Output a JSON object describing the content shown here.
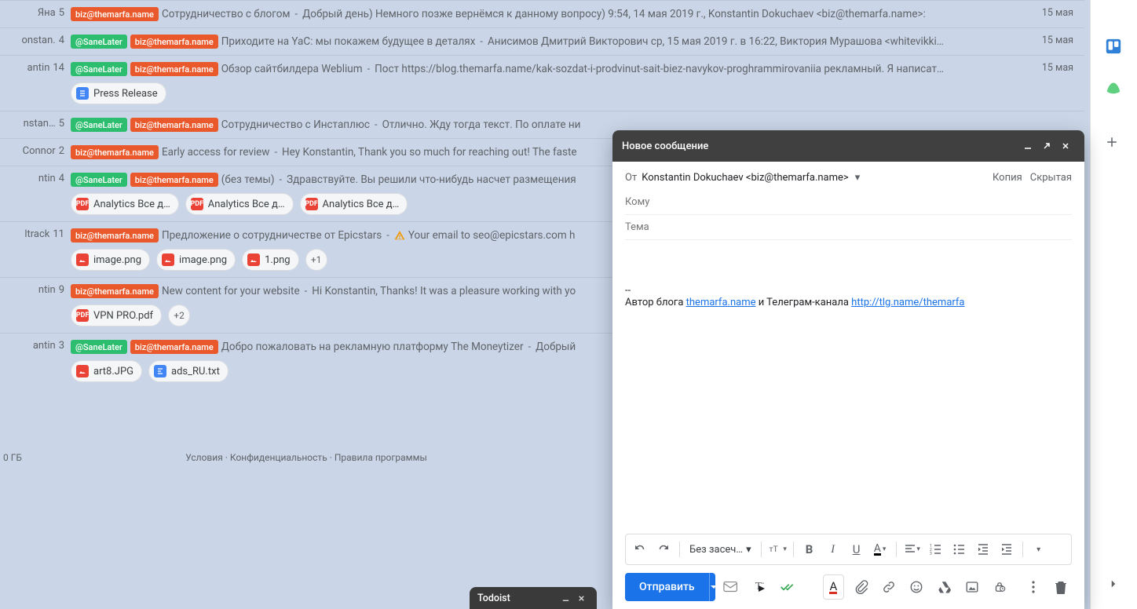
{
  "rows": [
    {
      "sender": "Яна",
      "count": "5",
      "tags": [
        {
          "t": "red",
          "v": "biz@themarfa.name"
        }
      ],
      "subject": "Сотрудничество с блогом",
      "snippet": "Добрый день) Немного позже вернёмся к данному вопросу) 9:54, 14 мая 2019 г., Konstantin Dokuchaev <biz@themarfa.name>:",
      "date": "15 мая",
      "chips": []
    },
    {
      "sender": "onstan.",
      "count": "4",
      "tags": [
        {
          "t": "green",
          "v": "@SaneLater"
        },
        {
          "t": "red",
          "v": "biz@themarfa.name"
        }
      ],
      "subject": "Приходите на YaC: мы покажем будущее в деталях",
      "snippet": "Анисимов Дмитрий Викторович ср, 15 мая 2019 г. в 16:22, Виктория Мурашова <whitevikki…",
      "date": "15 мая",
      "chips": []
    },
    {
      "sender": "antin",
      "count": "14",
      "tags": [
        {
          "t": "green",
          "v": "@SaneLater"
        },
        {
          "t": "red",
          "v": "biz@themarfa.name"
        }
      ],
      "subject": "Обзор сайтбилдера Weblium",
      "snippet": "Пост https://blog.themarfa.name/kak-sozdat-i-prodvinut-sait-biez-navykov-proghrammirovaniia рекламный. Я написат…",
      "date": "15 мая",
      "chips": [
        {
          "ic": "doc",
          "label": "Press Release"
        }
      ]
    },
    {
      "sender": "nstan…",
      "count": "5",
      "tags": [
        {
          "t": "green",
          "v": "@SaneLater"
        },
        {
          "t": "red",
          "v": "biz@themarfa.name"
        }
      ],
      "subject": "Сотрудничество с Инстаплюс",
      "snippet": "Отлично. Жду тогда текст. По оплате ни",
      "date": "",
      "chips": []
    },
    {
      "sender": "Connor",
      "count": "2",
      "tags": [
        {
          "t": "red",
          "v": "biz@themarfa.name"
        }
      ],
      "subject": "Early access for review",
      "snippet": "Hey Konstantin, Thank you so much for reaching out! The faste",
      "date": "",
      "chips": []
    },
    {
      "sender": "ntin",
      "count": "4",
      "tags": [
        {
          "t": "green",
          "v": "@SaneLater"
        },
        {
          "t": "red",
          "v": "biz@themarfa.name"
        }
      ],
      "subject": "(без темы)",
      "snippet": "Здравствуйте. Вы решили что-нибудь насчет размещения",
      "date": "",
      "chips": [
        {
          "ic": "pdf",
          "label": "Analytics Все д…"
        },
        {
          "ic": "pdf",
          "label": "Analytics Все д…"
        },
        {
          "ic": "pdf",
          "label": "Analytics Все д…"
        }
      ]
    },
    {
      "sender": "ltrack",
      "count": "11",
      "tags": [
        {
          "t": "red",
          "v": "biz@themarfa.name"
        }
      ],
      "subject": "Предложение о сотрудничестве от Epicstars",
      "snippet": "⚠ Your email to seo@epicstars.com h",
      "warn": true,
      "date": "",
      "chips": [
        {
          "ic": "img",
          "label": "image.png"
        },
        {
          "ic": "img",
          "label": "image.png"
        },
        {
          "ic": "img",
          "label": "1.png"
        },
        {
          "plus": "+1"
        }
      ]
    },
    {
      "sender": "ntin",
      "count": "9",
      "tags": [
        {
          "t": "red",
          "v": "biz@themarfa.name"
        }
      ],
      "subject": "New content for your website",
      "snippet": "Hi Konstantin, Thanks! It was a pleasure working with yo",
      "date": "",
      "chips": [
        {
          "ic": "pdf",
          "label": "VPN PRO.pdf"
        },
        {
          "plus": "+2"
        }
      ]
    },
    {
      "sender": "antin",
      "count": "3",
      "tags": [
        {
          "t": "green",
          "v": "@SaneLater"
        },
        {
          "t": "red",
          "v": "biz@themarfa.name"
        }
      ],
      "subject": "Добро пожаловать на рекламную платформу The Moneytizer",
      "snippet": "Добрый",
      "date": "",
      "chips": [
        {
          "ic": "img",
          "label": "art8.JPG"
        },
        {
          "ic": "txt",
          "label": "ads_RU.txt"
        }
      ]
    }
  ],
  "storage": "0 ГБ",
  "footer": {
    "terms": "Условия",
    "priv": "Конфиденциальность",
    "rules": "Правила программы"
  },
  "compose": {
    "title": "Новое сообщение",
    "from_label": "От",
    "from_value": "Konstantin Dokuchaev <biz@themarfa.name>",
    "cc": "Копия",
    "bcc": "Скрытая",
    "to_placeholder": "Кому",
    "subject_placeholder": "Тема",
    "sig_sep": "--",
    "sig_pre": "Автор блога ",
    "sig_link1": "themarfa.name",
    "sig_mid": " и Телеграм-канала ",
    "sig_link2": "http://tlg.name/themarfa",
    "font_label": "Без засеч…",
    "send": "Отправить"
  },
  "todoist": {
    "title": "Todoist"
  }
}
